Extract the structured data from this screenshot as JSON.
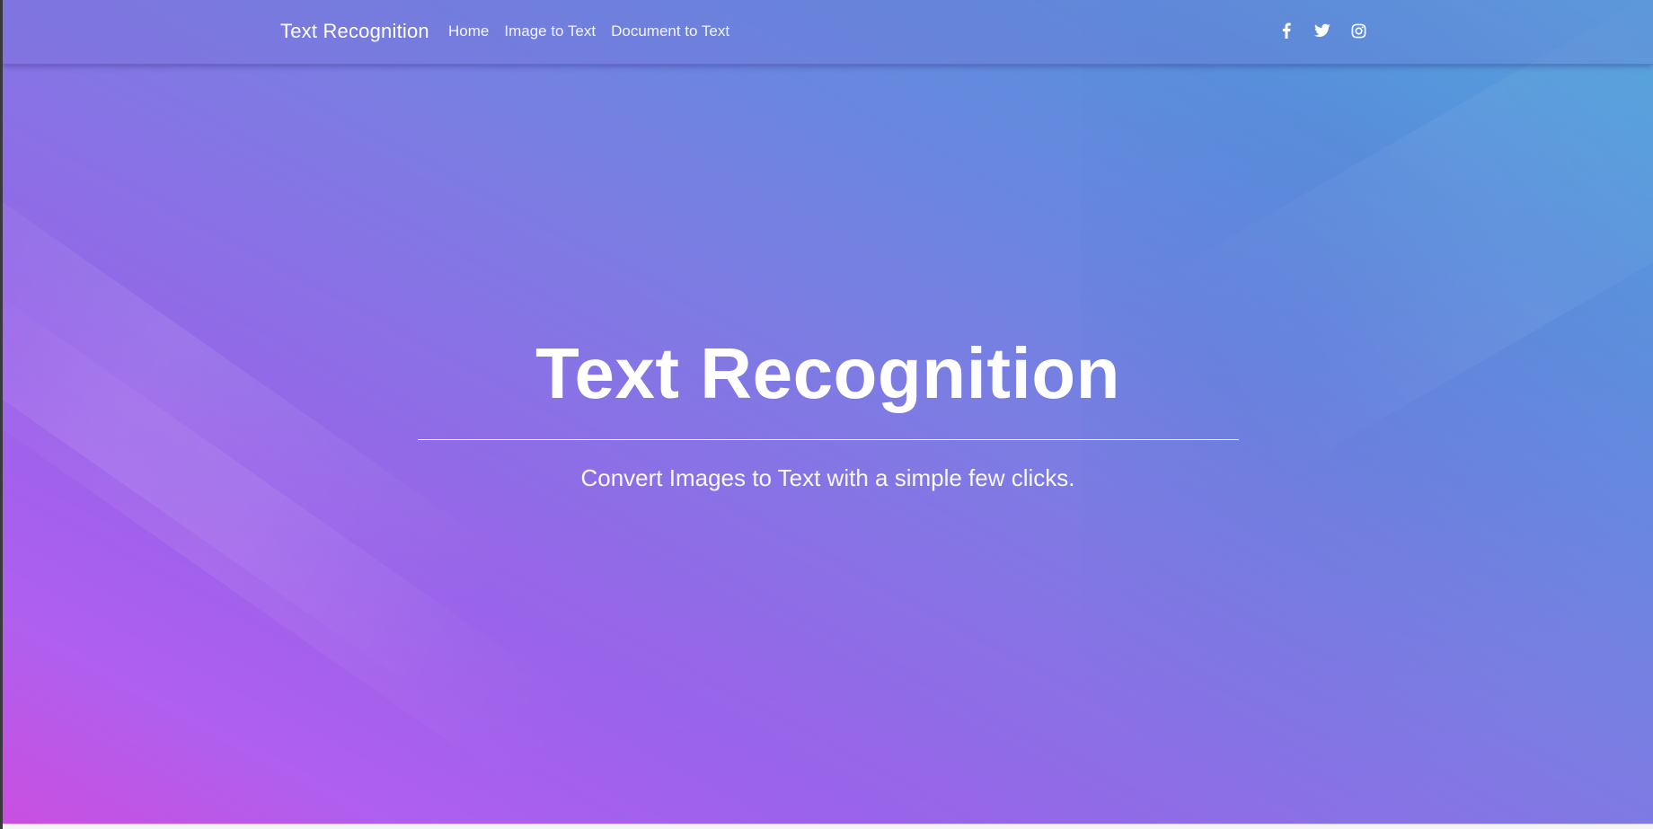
{
  "navbar": {
    "brand": "Text Recognition",
    "links": [
      {
        "label": "Home"
      },
      {
        "label": "Image to Text"
      },
      {
        "label": "Document to Text"
      }
    ],
    "social": [
      {
        "icon": "facebook-icon"
      },
      {
        "icon": "twitter-icon"
      },
      {
        "icon": "instagram-icon"
      }
    ]
  },
  "hero": {
    "title": "Text Recognition",
    "subtitle": "Convert Images to Text with a simple few clicks."
  },
  "colors": {
    "gradient_start": "#c94fe0",
    "gradient_mid": "#8c6fe6",
    "gradient_end": "#53a6dc",
    "text": "#ffffff"
  }
}
